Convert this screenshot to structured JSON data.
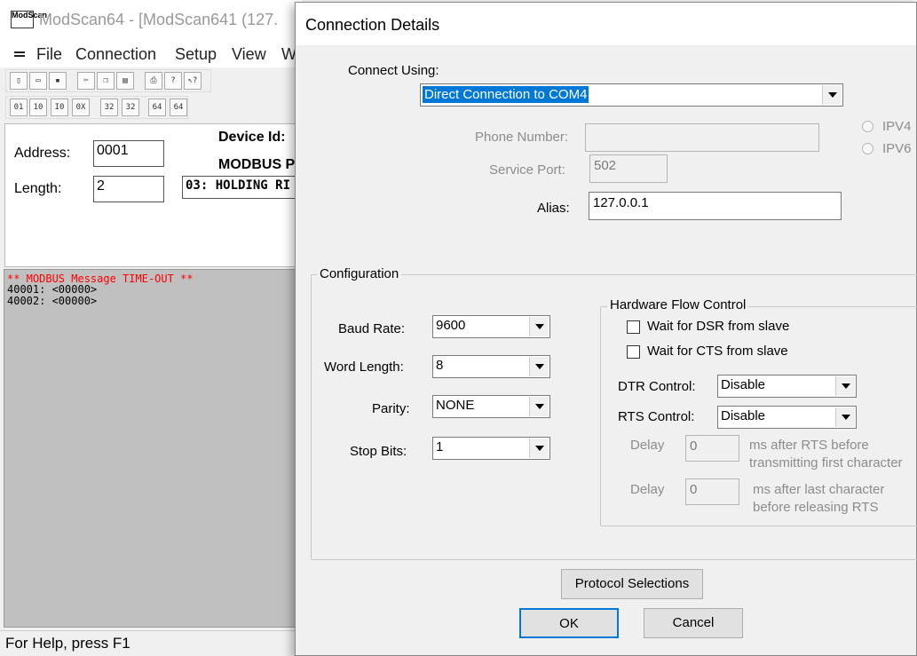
{
  "app": {
    "title": "ModScan64 - [ModScan641 (127.",
    "logo_text": "ModScan",
    "menu": [
      "File",
      "Connection",
      "Setup",
      "View",
      "W"
    ],
    "toolbar1": [
      "new",
      "open",
      "save",
      "cut",
      "copy",
      "paste",
      "print",
      "help",
      "context-help"
    ],
    "toolbar2": [
      "01",
      "10",
      "I0",
      "0X",
      "32",
      "32",
      "64",
      "64"
    ],
    "address_label": "Address:",
    "address_value": "0001",
    "length_label": "Length:",
    "length_value": "2",
    "device_id_label": "Device Id:",
    "modbus_point_label": "MODBUS P",
    "point_type_value": "03: HOLDING RI",
    "timeout_message": "** MODBUS Message TIME-OUT **",
    "data_lines": [
      "40001: <00000>",
      "40002: <00000>"
    ],
    "status_text": "For Help, press F1"
  },
  "dialog": {
    "title": "Connection Details",
    "connect_using_label": "Connect Using:",
    "connect_using_value": "Direct Connection to COM4",
    "phone_number_label": "Phone Number:",
    "phone_number_value": "",
    "service_port_label": "Service Port:",
    "service_port_value": "502",
    "ipv4_label": "IPV4",
    "ipv6_label": "IPV6",
    "alias_label": "Alias:",
    "alias_value": "127.0.0.1",
    "configuration": {
      "title": "Configuration",
      "baud_rate_label": "Baud Rate:",
      "baud_rate_value": "9600",
      "word_length_label": "Word Length:",
      "word_length_value": "8",
      "parity_label": "Parity:",
      "parity_value": "NONE",
      "stop_bits_label": "Stop Bits:",
      "stop_bits_value": "1"
    },
    "hardware_flow": {
      "title": "Hardware Flow Control",
      "dsr_label": "Wait for DSR from slave",
      "dsr_checked": false,
      "cts_label": "Wait for CTS from slave",
      "cts_checked": false,
      "dtr_label": "DTR Control:",
      "dtr_value": "Disable",
      "rts_label": "RTS Control:",
      "rts_value": "Disable",
      "delay_label": "Delay",
      "delay1_value": "0",
      "delay1_desc_1": "ms after RTS before",
      "delay1_desc_2": "transmitting first character",
      "delay2_value": "0",
      "delay2_desc_1": "ms after last character",
      "delay2_desc_2": "before releasing RTS"
    },
    "protocol_button": "Protocol Selections",
    "ok_button": "OK",
    "cancel_button": "Cancel"
  }
}
